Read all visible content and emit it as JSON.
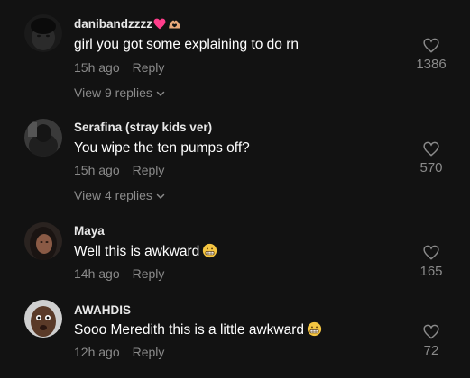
{
  "comments": [
    {
      "username": "danibandzzzz",
      "username_icons": [
        "heart-icon",
        "heart-hands-icon"
      ],
      "text": "girl you got some explaining to do rn",
      "time": "15h ago",
      "reply_label": "Reply",
      "likes": "1386",
      "view_replies": "View 9 replies"
    },
    {
      "username": "Serafina (stray kids ver)",
      "text": "You wipe the ten pumps off?",
      "time": "15h ago",
      "reply_label": "Reply",
      "likes": "570",
      "view_replies": "View 4 replies"
    },
    {
      "username": "Maya",
      "text": "Well this is awkward",
      "text_emoji": "grimacing-face-icon",
      "time": "14h ago",
      "reply_label": "Reply",
      "likes": "165"
    },
    {
      "username": "AWAHDIS",
      "text": "Sooo Meredith this is a little awkward",
      "text_emoji": "grimacing-face-icon",
      "time": "12h ago",
      "reply_label": "Reply",
      "likes": "72"
    }
  ],
  "colors": {
    "background": "#121212",
    "muted_text": "#8a8a8a",
    "username_text": "#e8e8e8",
    "body_text": "#ffffff",
    "pink_heart": "#fe2c55"
  }
}
